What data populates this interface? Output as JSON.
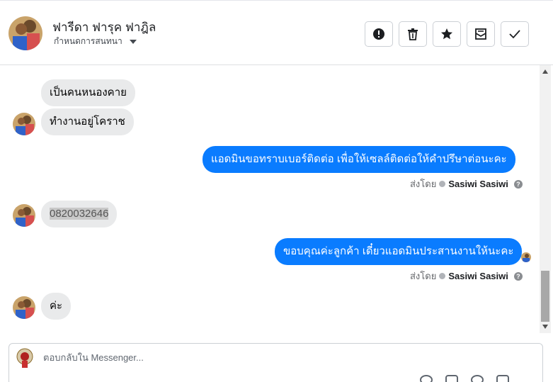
{
  "header": {
    "name": "ฟารีดา ฟารุค ฟาฎิล",
    "assign_label": "กำหนดการสนทนา"
  },
  "actions": [
    {
      "icon": "report-icon"
    },
    {
      "icon": "trash-icon"
    },
    {
      "icon": "star-icon"
    },
    {
      "icon": "mark-unread-icon"
    },
    {
      "icon": "checkmark-icon"
    }
  ],
  "messages": {
    "m1": "เป็นคนหนองคาย",
    "m2": "ทำงานอยู่โคราช",
    "m3": "แอดมินขอทราบเบอร์ติดต่อ เพื่อให้เซลล์ติดต่อให้คำปรึษาต่อนะคะ",
    "m4": "0820032646",
    "m5": "ขอบคุณค่ะลูกค้า เดี๋ยวแอดมินประสานงานให้นะคะ",
    "m6": "ค่ะ"
  },
  "sent_by": {
    "prefix": "ส่งโดย",
    "agent": "Sasiwi Sasiwi",
    "help": "?"
  },
  "composer": {
    "placeholder": "ตอบกลับใน Messenger..."
  },
  "colors": {
    "outgoing": "#0a7cff",
    "incoming": "#e9eaeb"
  }
}
